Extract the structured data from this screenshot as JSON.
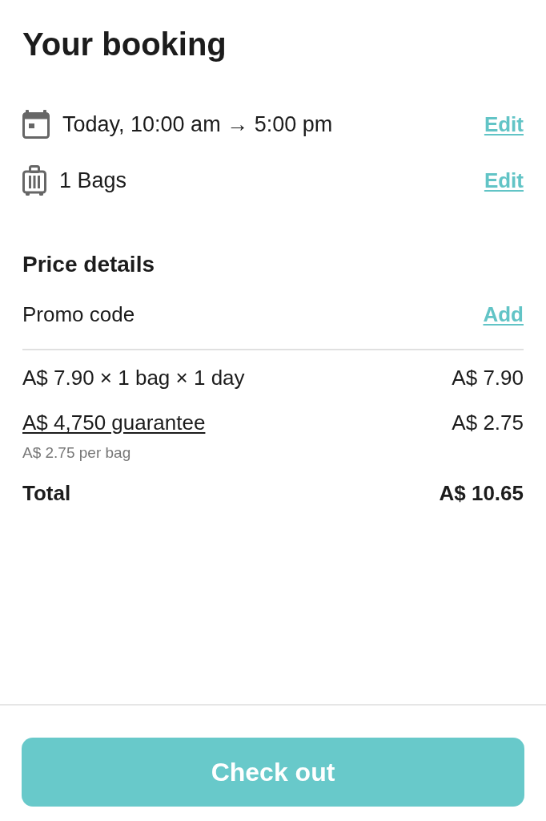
{
  "title": "Your booking",
  "booking": [
    {
      "kind": "date",
      "text": "Today, 10:00 am → 5:00 pm",
      "action": "Edit"
    },
    {
      "kind": "bags",
      "text": "1 Bags",
      "action": "Edit"
    }
  ],
  "price_details": {
    "title": "Price details",
    "promo": {
      "label": "Promo code",
      "action": "Add"
    },
    "lines": [
      {
        "kind": "plain",
        "label": "A$ 7.90 × 1 bag × 1 day",
        "amount": "A$ 7.90"
      },
      {
        "kind": "link",
        "label": "A$ 4,750 guarantee",
        "amount": "A$ 2.75",
        "note": "A$ 2.75 per bag"
      }
    ],
    "total": {
      "label": "Total",
      "amount": "A$ 10.65"
    }
  },
  "checkout_button": "Check out"
}
